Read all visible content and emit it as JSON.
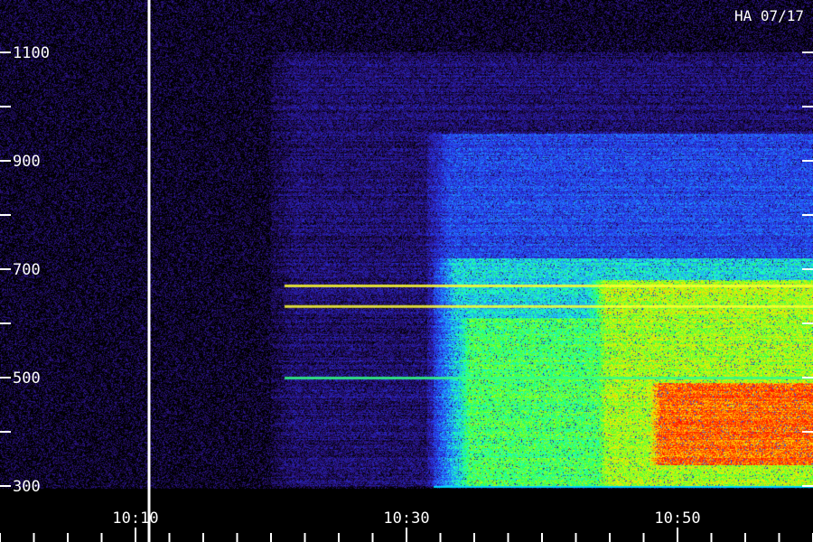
{
  "chart_data": {
    "type": "heatmap",
    "title": "HA 07/17",
    "x_tick_labels": [
      "10:10",
      "10:30",
      "10:50"
    ],
    "x_range_minutes": [
      600,
      660
    ],
    "x_major_ticks_minutes": [
      610,
      630,
      650
    ],
    "x_minor_step_minutes": 2.5,
    "y_tick_labels": [
      "300",
      "500",
      "700",
      "900",
      "1100"
    ],
    "y_major_ticks": [
      300,
      500,
      700,
      900,
      1100
    ],
    "y_minor_ticks": [
      400,
      600,
      800,
      1000
    ],
    "y_range": [
      300,
      1100
    ],
    "event_marker_time_minutes": 610,
    "intensity_bands": [
      {
        "t_start": 620,
        "t_end": 660,
        "y_min": 300,
        "y_max": 1100,
        "level": 0.12
      },
      {
        "t_start": 631.5,
        "t_end": 660,
        "y_min": 300,
        "y_max": 950,
        "level": 0.3
      },
      {
        "t_start": 632,
        "t_end": 660,
        "y_min": 300,
        "y_max": 720,
        "level": 0.48
      },
      {
        "t_start": 633,
        "t_end": 660,
        "y_min": 300,
        "y_max": 610,
        "level": 0.62
      },
      {
        "t_start": 643,
        "t_end": 660,
        "y_min": 300,
        "y_max": 680,
        "level": 0.72
      },
      {
        "t_start": 647,
        "t_end": 660,
        "y_min": 340,
        "y_max": 490,
        "level": 0.92
      }
    ],
    "narrowband_lines": [
      {
        "y": 670,
        "t_start": 620,
        "t_end": 660,
        "color": "#ffff33"
      },
      {
        "y": 632,
        "t_start": 620,
        "t_end": 660,
        "color": "#ffff33"
      },
      {
        "y": 500,
        "t_start": 620,
        "t_end": 660,
        "color": "#33ff88"
      }
    ],
    "colors": {
      "background": "#000000",
      "low": "#1a0a55",
      "mid_low": "#2a3cff",
      "mid": "#22ffcc",
      "mid_high": "#b8ff00",
      "high": "#ff2a00",
      "axis": "#ffffff"
    }
  }
}
